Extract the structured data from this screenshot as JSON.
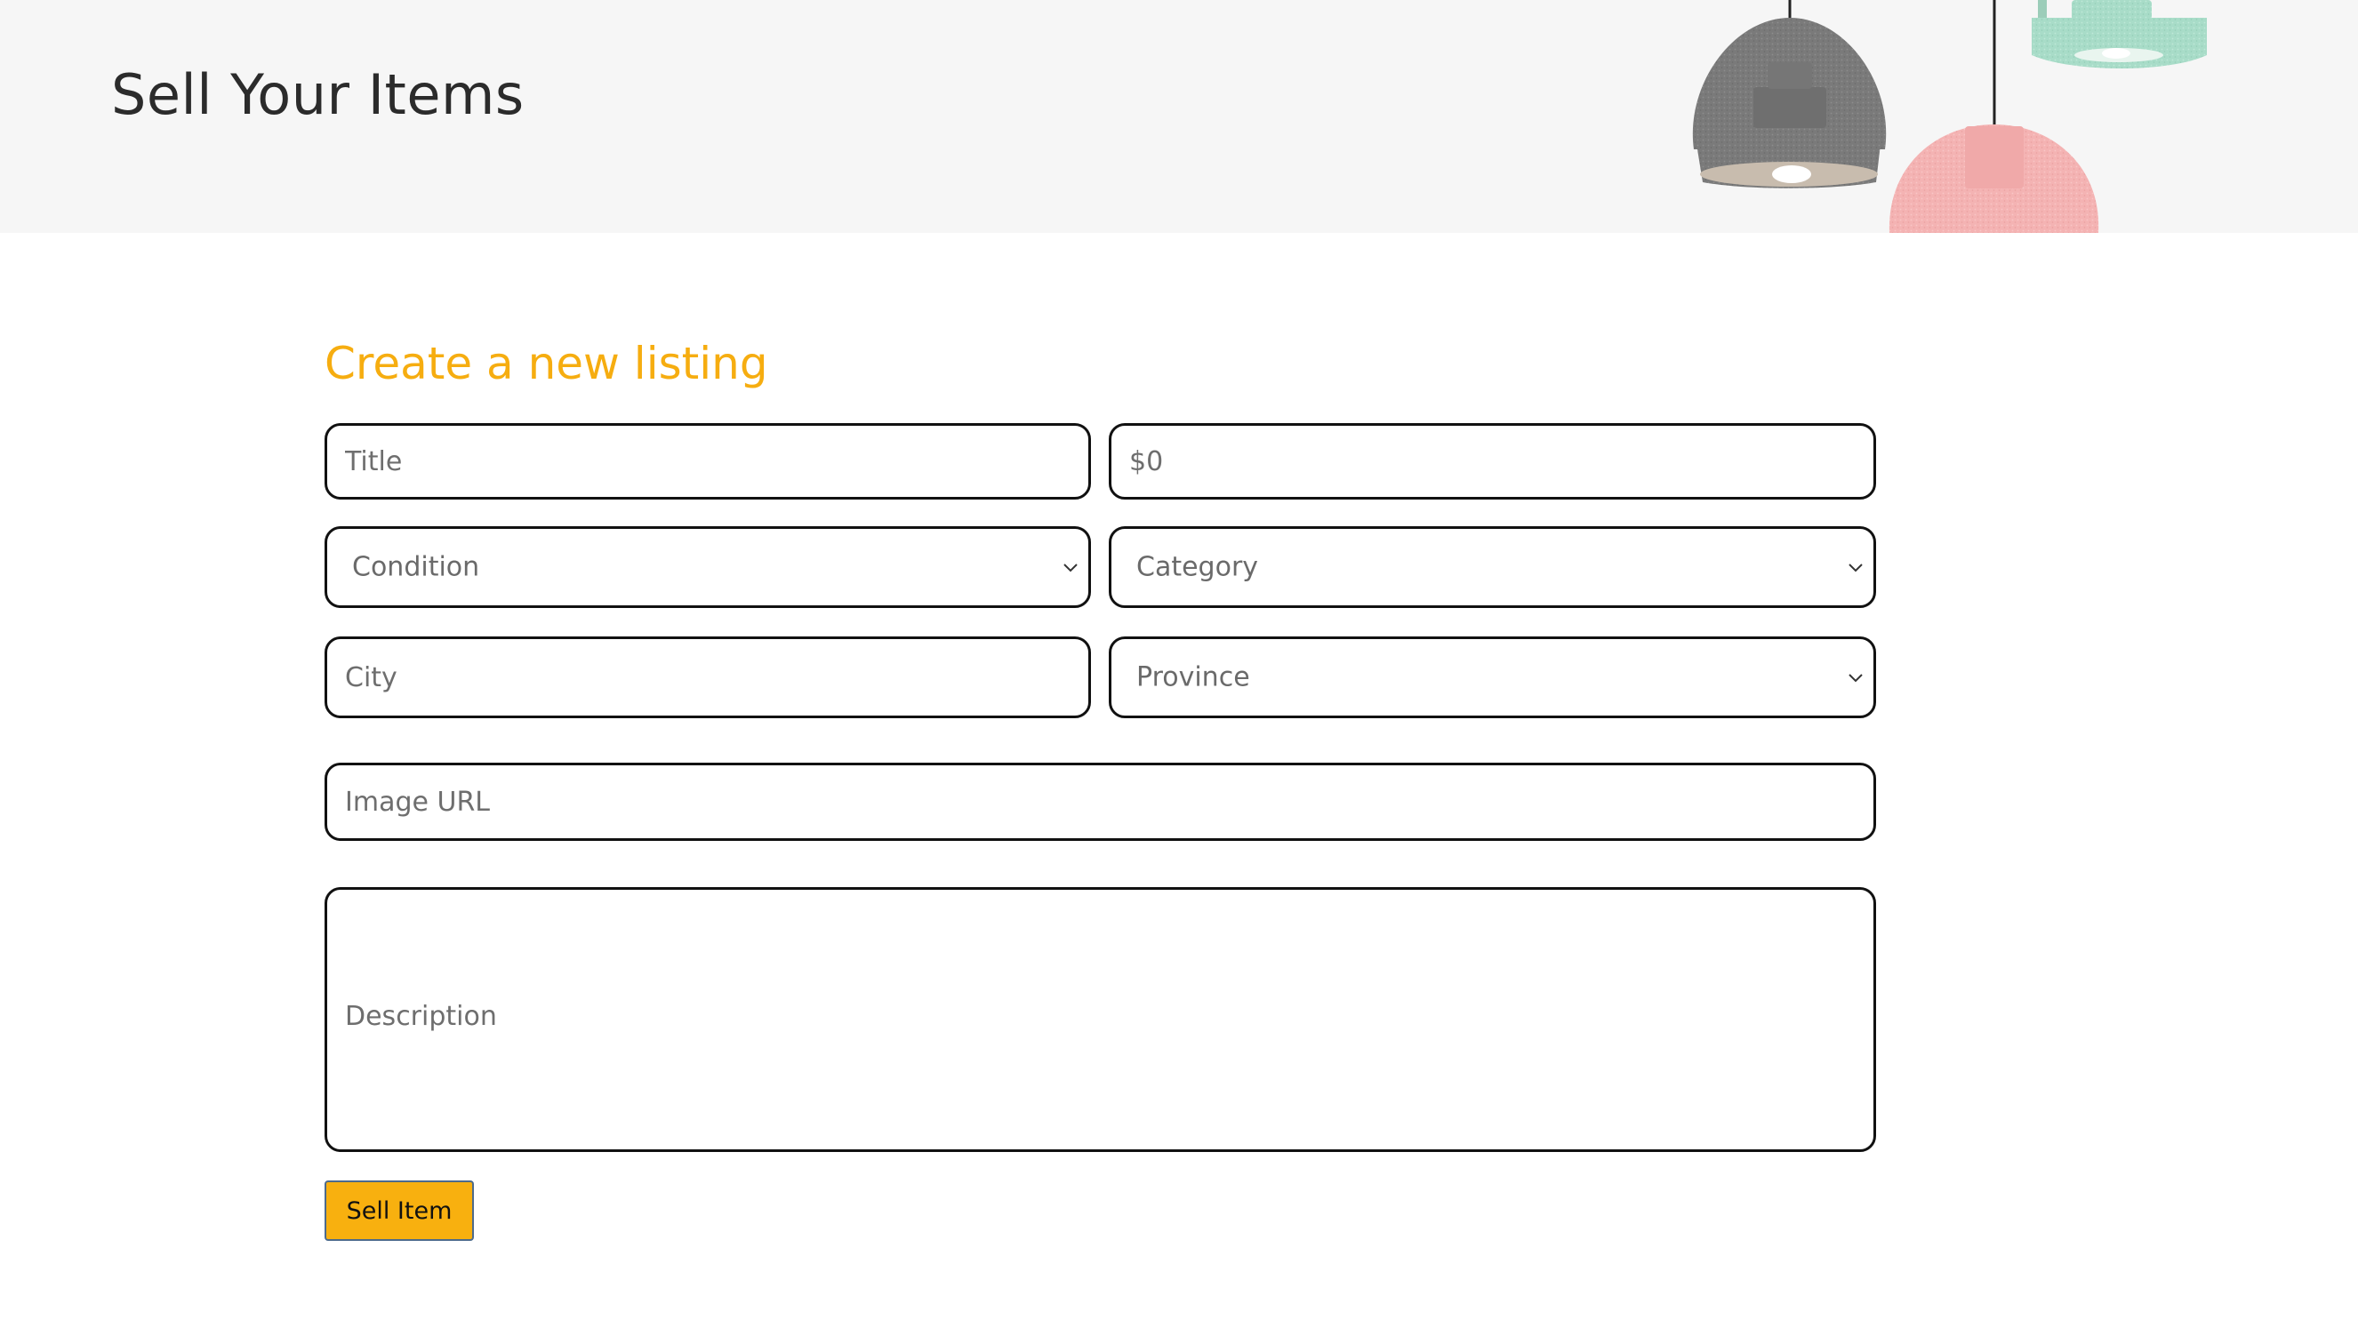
{
  "header": {
    "title": "Sell Your Items"
  },
  "form": {
    "heading": "Create a new listing",
    "title_placeholder": "Title",
    "price_placeholder": "$0",
    "condition_value": "Condition",
    "category_value": "Category",
    "city_placeholder": "City",
    "province_value": "Province",
    "image_url_placeholder": "Image URL",
    "description_placeholder": "Description",
    "submit_label": "Sell Item"
  },
  "colors": {
    "accent": "#f6ad10",
    "button": "#f8b00f",
    "header_bg": "#f6f6f6",
    "border": "#111111"
  },
  "icons": {
    "select_arrow": "chevron-down-icon",
    "hero": "pendant-lamps-illustration"
  }
}
